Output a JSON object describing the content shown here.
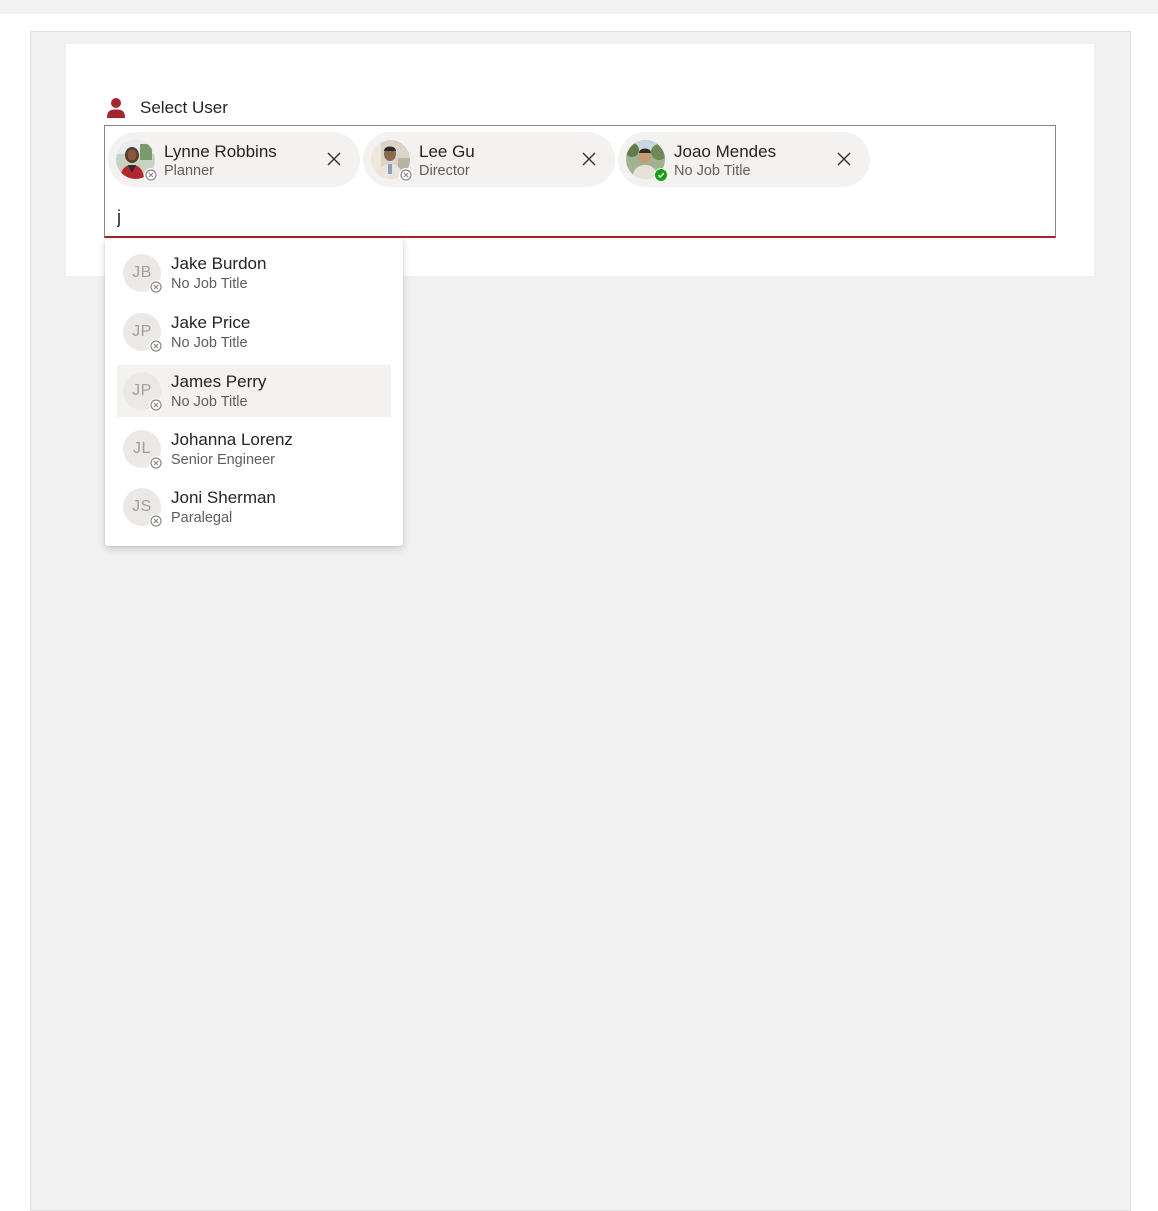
{
  "field": {
    "label": "Select User",
    "query": "j",
    "accent_color": "#a4262c"
  },
  "selected_users": [
    {
      "name": "Lynne Robbins",
      "title": "Planner",
      "presence": "offline",
      "remove_icon": "close-icon"
    },
    {
      "name": "Lee Gu",
      "title": "Director",
      "presence": "offline",
      "remove_icon": "close-icon"
    },
    {
      "name": "Joao Mendes",
      "title": "No Job Title",
      "presence": "available",
      "remove_icon": "close-icon"
    }
  ],
  "suggestions": [
    {
      "initials": "JB",
      "name": "Jake Burdon",
      "title": "No Job Title",
      "presence": "offline",
      "selected": false
    },
    {
      "initials": "JP",
      "name": "Jake Price",
      "title": "No Job Title",
      "presence": "offline",
      "selected": false
    },
    {
      "initials": "JP",
      "name": "James Perry",
      "title": "No Job Title",
      "presence": "offline",
      "selected": true
    },
    {
      "initials": "JL",
      "name": "Johanna Lorenz",
      "title": "Senior Engineer",
      "presence": "offline",
      "selected": false
    },
    {
      "initials": "JS",
      "name": "Joni Sherman",
      "title": "Paralegal",
      "presence": "offline",
      "selected": false
    }
  ],
  "colors": {
    "available": "#13a10e",
    "offline": "#8a8886",
    "selected_row": "#f3f2f1"
  }
}
